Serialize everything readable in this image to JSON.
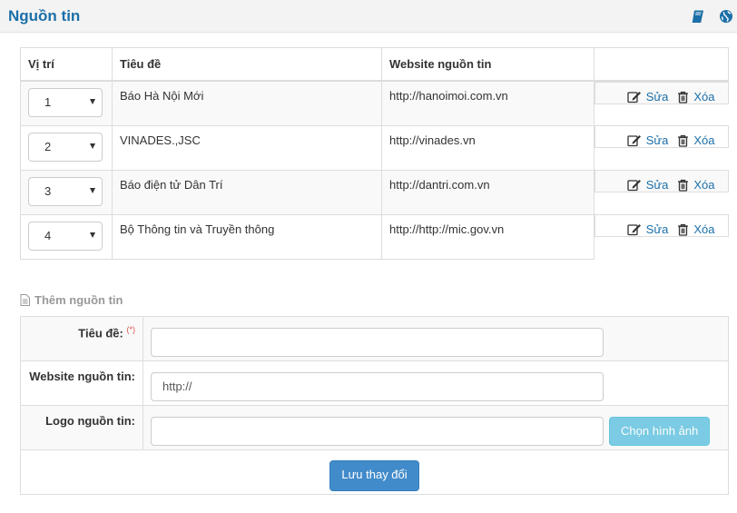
{
  "header": {
    "title": "Nguồn tin"
  },
  "list": {
    "columns": [
      "Vị trí",
      "Tiêu đề",
      "Website nguồn tin",
      ""
    ],
    "rows": [
      {
        "position": "1",
        "title": "Báo Hà Nội Mới",
        "website": "http://hanoimoi.com.vn"
      },
      {
        "position": "2",
        "title": "VINADES.,JSC",
        "website": "http://vinades.vn"
      },
      {
        "position": "3",
        "title": "Báo điện tử Dân Trí",
        "website": "http://dantri.com.vn"
      },
      {
        "position": "4",
        "title": "Bộ Thông tin và Truyền thông",
        "website": "http://http://mic.gov.vn"
      }
    ],
    "edit_label": "Sửa",
    "delete_label": "Xóa"
  },
  "form": {
    "caption": "Thêm nguồn tin",
    "title_label": "Tiêu đề:",
    "required_mark": "(*)",
    "title_value": "",
    "website_label": "Website nguồn tin:",
    "website_value": "http://",
    "logo_label": "Logo nguồn tin:",
    "logo_value": "",
    "choose_image_label": "Chọn hình ảnh",
    "save_label": "Lưu thay đổi"
  },
  "colors": {
    "accent": "#1b6fa8",
    "info_button": "#5bc0de",
    "primary_button": "#428bca",
    "required": "#d9534f"
  },
  "icons": {
    "header_book": "book-icon",
    "header_globe": "globe-icon",
    "edit": "edit-icon",
    "delete": "trash-icon",
    "caption": "file-icon"
  }
}
